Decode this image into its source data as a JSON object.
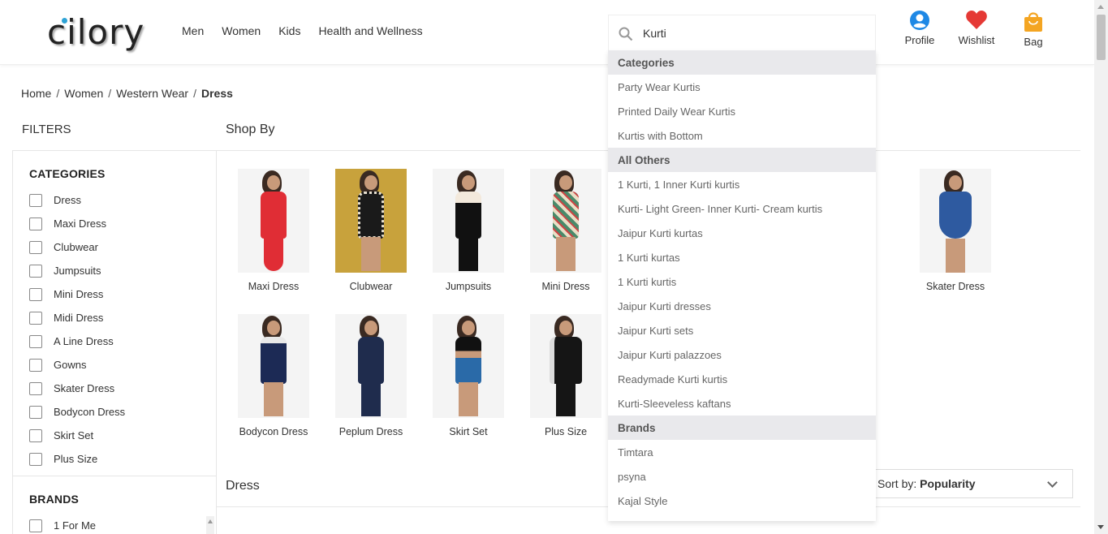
{
  "header": {
    "logo": "cilory",
    "nav": [
      "Men",
      "Women",
      "Kids",
      "Health and Wellness"
    ],
    "icons": [
      {
        "label": "Profile",
        "icon": "profile-icon",
        "color": "#1e88e5"
      },
      {
        "label": "Wishlist",
        "icon": "heart-icon",
        "color": "#e53935"
      },
      {
        "label": "Bag",
        "icon": "bag-icon",
        "color": "#f4a522"
      }
    ]
  },
  "breadcrumb": [
    "Home",
    "Women",
    "Western Wear",
    "Dress"
  ],
  "filters_title": "FILTERS",
  "shopby_title": "Shop By",
  "sidebar": {
    "categories_title": "CATEGORIES",
    "categories": [
      "Dress",
      "Maxi Dress",
      "Clubwear",
      "Jumpsuits",
      "Mini Dress",
      "Midi Dress",
      "A Line Dress",
      "Gowns",
      "Skater Dress",
      "Bodycon Dress",
      "Skirt Set",
      "Plus Size"
    ],
    "brands_title": "BRANDS",
    "brands": [
      "1 For Me"
    ]
  },
  "shopby": [
    {
      "label": "Maxi Dress",
      "color": "#e02d35",
      "bg": "#f4f4f4"
    },
    {
      "label": "Clubwear",
      "color": "#1a1a1a",
      "bg": "#c8a23c"
    },
    {
      "label": "Jumpsuits",
      "color": "#111111",
      "bg": "#f4f4f4"
    },
    {
      "label": "Mini Dress",
      "color": "#4a8a6a",
      "bg": "#f4f4f4"
    },
    {
      "label": "Skater Dress",
      "color": "#2e5aa0",
      "bg": "#f4f4f4"
    },
    {
      "label": "Bodycon Dress",
      "color": "#1c2a55",
      "bg": "#f4f4f4"
    },
    {
      "label": "Peplum Dress",
      "color": "#1f2c4d",
      "bg": "#f4f4f4"
    },
    {
      "label": "Skirt Set",
      "color": "#2a6aa8",
      "bg": "#f4f4f4"
    },
    {
      "label": "Plus Size",
      "color": "#151515",
      "bg": "#f4f4f4"
    }
  ],
  "section_title": "Dress",
  "sort": {
    "prefix": "Sort by:",
    "value": "Popularity"
  },
  "search": {
    "value": "Kurti",
    "sections": [
      {
        "title": "Categories",
        "items": [
          "Party Wear Kurtis",
          "Printed Daily Wear Kurtis",
          "Kurtis with Bottom"
        ]
      },
      {
        "title": "All Others",
        "items": [
          "1 Kurti, 1 Inner Kurti kurtis",
          "Kurti- Light Green- Inner Kurti- Cream kurtis",
          "Jaipur Kurti kurtas",
          "1 Kurti kurtas",
          "1 Kurti kurtis",
          "Jaipur Kurti dresses",
          "Jaipur Kurti sets",
          "Jaipur Kurti palazzoes",
          "Readymade Kurti kurtis",
          "Kurti-Sleeveless kaftans"
        ]
      },
      {
        "title": "Brands",
        "items": [
          "Timtara",
          "psyna",
          "Kajal Style"
        ]
      }
    ]
  }
}
